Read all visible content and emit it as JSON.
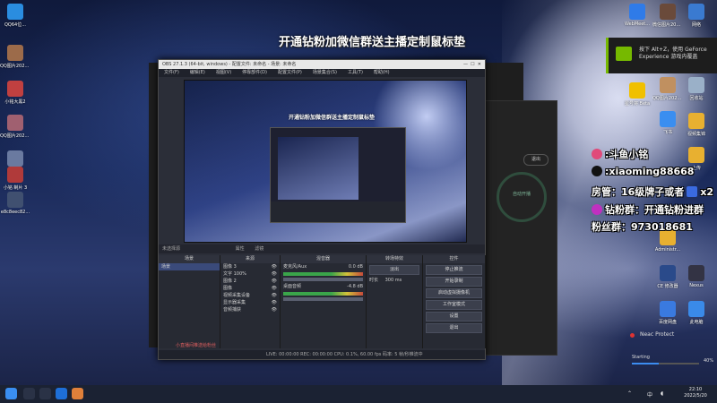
{
  "banner": {
    "text": "开通钻粉加微信群送主播定制鼠标垫"
  },
  "nvidia_toast": {
    "text": "按下 Alt+Z，使用 GeForce Experience 游戏内覆盖"
  },
  "overlay": {
    "douyu": ":斗鱼小铭",
    "douyin": ":xiaoming88668",
    "fangguan": "房管：16级牌子或者",
    "fangguan_suffix": "x2",
    "zuanfen": "钻粉群：开通钻粉进群",
    "fensi": "粉丝群：973018681"
  },
  "desktop_left": [
    {
      "label": "QQ64位...",
      "color": "#2a8de0"
    },
    {
      "label": "QQ图片20220506...",
      "color": "#9c6b4a"
    },
    {
      "label": "小铭大黑2",
      "color": "#c04040"
    },
    {
      "label": "QQ图片20220510...",
      "color": "#a06070"
    },
    {
      "label": "QQ图片",
      "color": "#6a7aa0"
    },
    {
      "label": "小铭 制片 3",
      "color": "#b03a3a"
    },
    {
      "label": "e8c8eec82...",
      "color": "#405070"
    }
  ],
  "desktop_right": [
    {
      "label": "WebMeet...",
      "color": "#2f7be8"
    },
    {
      "label": "微信图片20220...",
      "color": "#6a4a3a"
    },
    {
      "label": "网络",
      "color": "#3a7ad0"
    },
    {
      "label": "QQ图片20220...",
      "color": "#c09060"
    },
    {
      "label": "回收站",
      "color": "#9ab0c8"
    },
    {
      "label": "星号将 Beta",
      "color": "#f0c000"
    },
    {
      "label": "视频集锦",
      "color": "#e8b030"
    },
    {
      "label": "飞书",
      "color": "#3a8ef0"
    },
    {
      "label": "上传",
      "color": "#e8b030"
    },
    {
      "label": "Administr...",
      "color": "#e8b030"
    },
    {
      "label": "CE 修改器",
      "color": "#2a4a8a"
    },
    {
      "label": "Nexus",
      "color": "#333344"
    },
    {
      "label": "百度网盘",
      "color": "#3a7ae0"
    },
    {
      "label": "此电脑",
      "color": "#3a8ae8"
    }
  ],
  "companion": {
    "exit_label": "退出",
    "ring_label": "自动开播"
  },
  "obs": {
    "title": "OBS 27.1.3 (64-bit, windows) - 配置文件: 未命名 - 场景: 未命名",
    "menu": [
      "文件(F)",
      "编辑(E)",
      "视图(V)",
      "停靠部件(D)",
      "配置文件(P)",
      "场景集合(S)",
      "工具(T)",
      "帮助(H)"
    ],
    "preview_banner": "开通钻粉加微信群送主播定制鼠标垫",
    "source_bar": [
      "未选择源",
      "属性",
      "滤镜"
    ],
    "scenes_title": "场景",
    "scenes": [
      "场景"
    ],
    "sources_title": "来源",
    "sources": [
      "图像 3",
      "文字 100%",
      "图像 2",
      "图像",
      "视频采集设备",
      "显示器采集",
      "音频捕获"
    ],
    "mixer_title": "混音器",
    "mixer": [
      {
        "name": "麦克风/Aux",
        "db": "0.0 dB"
      },
      {
        "name": "桌面音频",
        "db": "-4.8 dB"
      }
    ],
    "transition_title": "转场特效",
    "transition": {
      "type": "淡出",
      "duration_label": "时长",
      "duration": "300 ms"
    },
    "controls_title": "控件",
    "controls": [
      "停止推流",
      "开始录制",
      "启动虚拟摄像机",
      "工作室模式",
      "设置",
      "退出"
    ],
    "status": "LIVE: 00:00:00   REC: 00:00:00   CPU: 0.1%, 60.00 fps   码率: 5 帧/秒推流中"
  },
  "gift_area": {
    "hint": "小直播间推送给粉丝"
  },
  "neac": {
    "label": "Neac Protect"
  },
  "starting": {
    "label": "Starting",
    "percent": "40%",
    "progress": 0.4
  },
  "clock": {
    "time": "22:10",
    "date": "2022/5/20"
  },
  "tray": {
    "ime": "中"
  }
}
